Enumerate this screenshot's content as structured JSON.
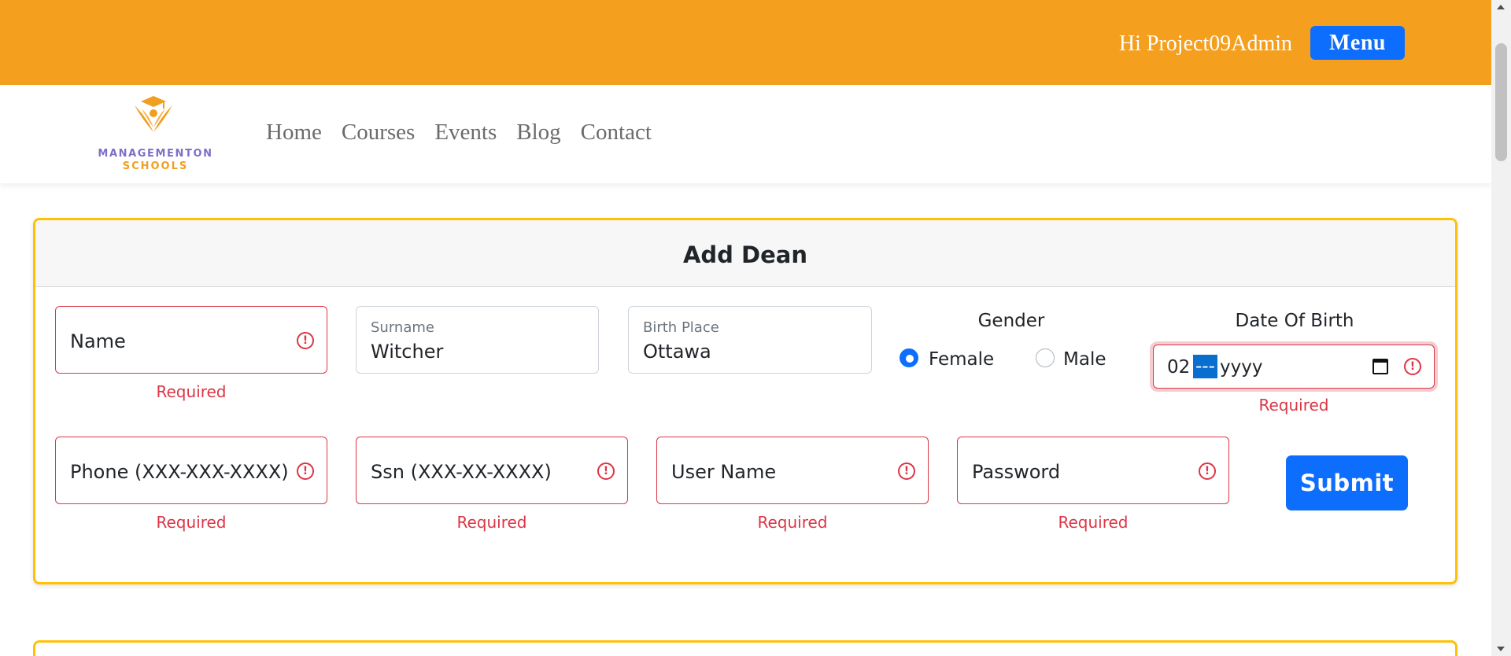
{
  "header": {
    "greeting": "Hi Project09Admin",
    "menu_label": "Menu",
    "accent_color": "#f49f1e",
    "button_color": "#0d6efd"
  },
  "logo": {
    "line1": "MANAGEMENTON",
    "line2": "SCHOOLS"
  },
  "nav": {
    "items": [
      {
        "label": "Home"
      },
      {
        "label": "Courses"
      },
      {
        "label": "Events"
      },
      {
        "label": "Blog"
      },
      {
        "label": "Contact"
      }
    ]
  },
  "form": {
    "title": "Add Dean",
    "name": {
      "placeholder": "Name",
      "error": "Required"
    },
    "surname": {
      "label": "Surname",
      "value": "Witcher"
    },
    "birth_place": {
      "label": "Birth Place",
      "value": "Ottawa"
    },
    "gender": {
      "title": "Gender",
      "options": [
        {
          "label": "Female",
          "checked": true
        },
        {
          "label": "Male",
          "checked": false
        }
      ]
    },
    "dob": {
      "title": "Date Of Birth",
      "day": "02",
      "month": "---",
      "year": "yyyy",
      "error": "Required"
    },
    "phone": {
      "placeholder": "Phone (XXX-XXX-XXXX)",
      "error": "Required"
    },
    "ssn": {
      "placeholder": "Ssn (XXX-XX-XXXX)",
      "error": "Required"
    },
    "username": {
      "placeholder": "User Name",
      "error": "Required"
    },
    "password": {
      "placeholder": "Password",
      "error": "Required"
    },
    "submit_label": "Submit",
    "error_color": "#dc3545"
  }
}
